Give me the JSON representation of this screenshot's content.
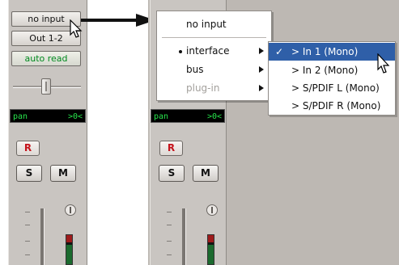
{
  "left_strip": {
    "input_label": "no input",
    "output_label": "Out 1-2",
    "automation_label": "auto read",
    "pan_label": "pan",
    "pan_value": ">0<",
    "record_label": "R",
    "solo_label": "S",
    "mute_label": "M"
  },
  "right_strip": {
    "pan_label": "pan",
    "pan_value": ">0<",
    "record_label": "R",
    "solo_label": "S",
    "mute_label": "M"
  },
  "menu": {
    "title_item": "no input",
    "items": [
      {
        "label": "interface",
        "selected": true,
        "disabled": false,
        "submenu": true
      },
      {
        "label": "bus",
        "selected": false,
        "disabled": false,
        "submenu": true
      },
      {
        "label": "plug-in",
        "selected": false,
        "disabled": true,
        "submenu": true
      }
    ]
  },
  "submenu": {
    "items": [
      {
        "label": "> In 1 (Mono)",
        "checked": true
      },
      {
        "label": "> In 2 (Mono)",
        "checked": false
      },
      {
        "label": "> S/PDIF L (Mono)",
        "checked": false
      },
      {
        "label": "> S/PDIF R (Mono)",
        "checked": false
      }
    ],
    "check_glyph": "✓"
  },
  "colors": {
    "selection": "#2f5fa8",
    "pan_text": "#27e24b",
    "record_text": "#c5141c",
    "automation_text": "#008a1e"
  }
}
